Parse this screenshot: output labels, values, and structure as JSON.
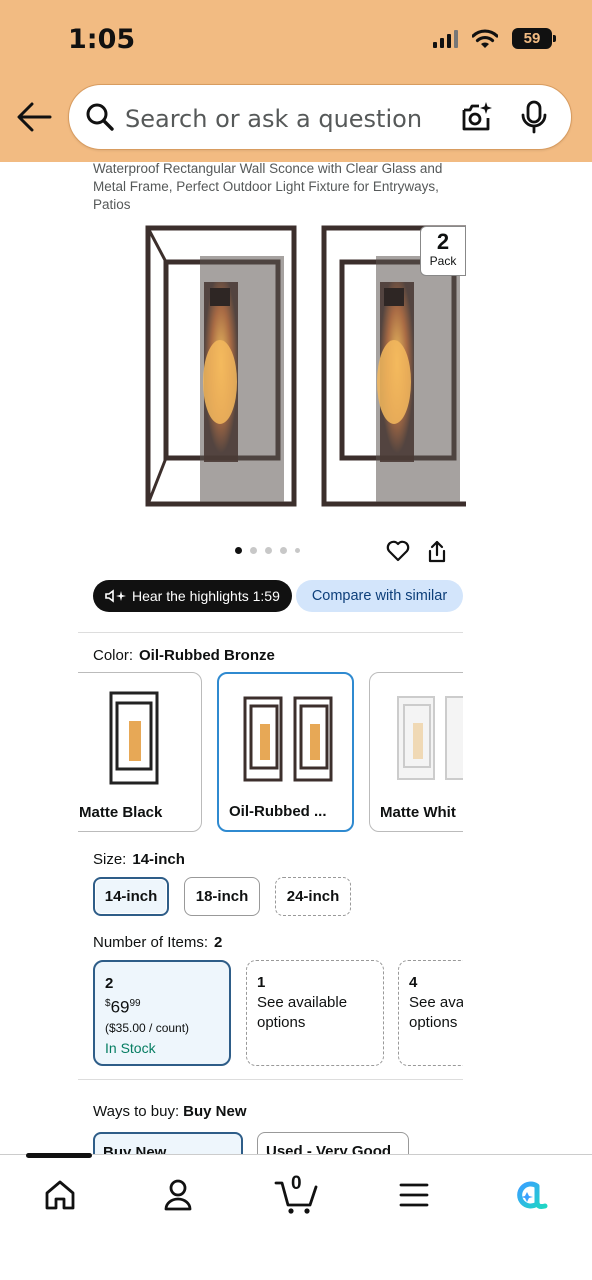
{
  "status": {
    "time": "1:05",
    "battery": "59"
  },
  "search": {
    "placeholder": "Search or ask a question"
  },
  "icons": [
    "back-arrow-icon",
    "search-icon",
    "camera-icon",
    "microphone-icon",
    "heart-icon",
    "share-icon",
    "speaker-icon",
    "home-icon",
    "account-icon",
    "cart-icon",
    "menu-icon",
    "rufus-ai-icon"
  ],
  "product": {
    "title": "Waterproof Rectangular Wall Sconce with Clear Glass and Metal Frame, Perfect Outdoor Light Fixture for Entryways, Patios",
    "pack_count": "2",
    "pack_label": "Pack",
    "image_count": 5,
    "active_image": 1
  },
  "actions": {
    "highlights": "Hear the highlights 1:59",
    "compare": "Compare with similar"
  },
  "color": {
    "label": "Color:",
    "selected": "Oil-Rubbed Bronze",
    "options": [
      "Matte Black",
      "Oil-Rubbed ...",
      "Matte Whit"
    ]
  },
  "size": {
    "label": "Size:",
    "selected": "14-inch",
    "options": [
      "14-inch",
      "18-inch",
      "24-inch"
    ]
  },
  "items": {
    "label": "Number of Items:",
    "selected": "2",
    "options": [
      {
        "count": "2",
        "price_dollars": "69",
        "price_cents": "99",
        "currency": "$",
        "per_count": "($35.00 / count)",
        "stock": "In Stock"
      },
      {
        "count": "1",
        "text": "See available options"
      },
      {
        "count": "4",
        "text": "See ava options"
      }
    ]
  },
  "ways_to_buy": {
    "label": "Ways to buy:",
    "selected": "Buy New",
    "options": [
      "Buy New",
      "Used - Very Good"
    ]
  },
  "nav": {
    "cart_count": "0"
  },
  "colors": {
    "header_bg": "#f2bb82",
    "accent_blue": "#2f8ad0",
    "in_stock_green": "#067d62"
  }
}
